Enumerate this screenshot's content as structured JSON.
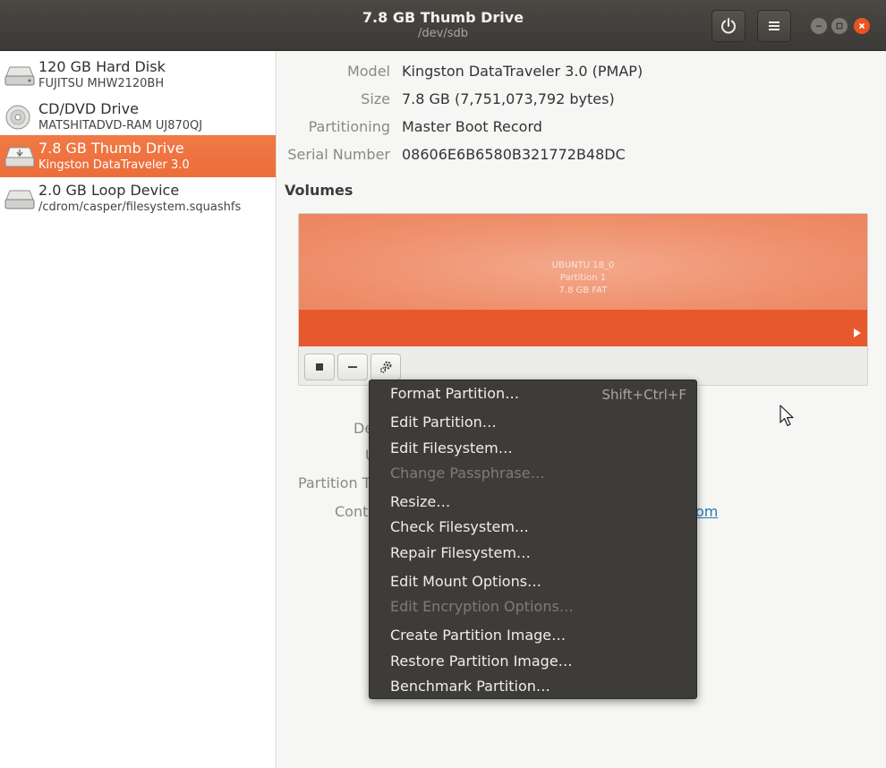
{
  "window": {
    "title": "7.8 GB Thumb Drive",
    "subtitle": "/dev/sdb"
  },
  "icons": {
    "power": "power-icon",
    "menu": "hamburger-menu-icon",
    "minimize": "minimize-icon",
    "maximize": "maximize-icon",
    "close": "close-icon"
  },
  "sidebar": {
    "items": [
      {
        "name": "120 GB Hard Disk",
        "sub": "FUJITSU MHW2120BH",
        "icon": "hard-disk-icon",
        "selected": false
      },
      {
        "name": "CD/DVD Drive",
        "sub": "MATSHITADVD-RAM UJ870QJ",
        "icon": "optical-disc-icon",
        "selected": false
      },
      {
        "name": "7.8 GB Thumb Drive",
        "sub": "Kingston DataTraveler 3.0",
        "icon": "usb-drive-icon",
        "selected": true
      },
      {
        "name": "2.0 GB Loop Device",
        "sub": "/cdrom/casper/filesystem.squashfs",
        "icon": "loop-device-icon",
        "selected": false
      }
    ]
  },
  "properties": {
    "model_label": "Model",
    "model_value": "Kingston DataTraveler 3.0 (PMAP)",
    "size_label": "Size",
    "size_value": "7.8 GB (7,751,073,792 bytes)",
    "partitioning_label": "Partitioning",
    "partitioning_value": "Master Boot Record",
    "serial_label": "Serial Number",
    "serial_value": "08606E6B6580B321772B48DC"
  },
  "volumes": {
    "heading": "Volumes",
    "partition_name": "UBUNTU 18_0",
    "partition_number": "Partition 1",
    "partition_size": "7.8 GB FAT"
  },
  "partially_hidden": {
    "device_fragment": "De",
    "uuid_fragment": "U",
    "partition_type_fragment": "Partition T",
    "contents_fragment": "Cont",
    "link_fragment": "om"
  },
  "menu": {
    "items": [
      {
        "label": "Format Partition…",
        "accel": "Shift+Ctrl+F",
        "enabled": true
      },
      {
        "label": "Edit Partition…",
        "accel": "",
        "enabled": true
      },
      {
        "label": "Edit Filesystem…",
        "accel": "",
        "enabled": true
      },
      {
        "label": "Change Passphrase…",
        "accel": "",
        "enabled": false
      },
      {
        "label": "Resize…",
        "accel": "",
        "enabled": true
      },
      {
        "label": "Check Filesystem…",
        "accel": "",
        "enabled": true
      },
      {
        "label": "Repair Filesystem…",
        "accel": "",
        "enabled": true
      },
      {
        "label": "Edit Mount Options…",
        "accel": "",
        "enabled": true
      },
      {
        "label": "Edit Encryption Options…",
        "accel": "",
        "enabled": false
      },
      {
        "label": "Create Partition Image…",
        "accel": "",
        "enabled": true
      },
      {
        "label": "Restore Partition Image…",
        "accel": "",
        "enabled": true
      },
      {
        "label": "Benchmark Partition…",
        "accel": "",
        "enabled": true
      }
    ]
  },
  "colors": {
    "accent": "#e95420",
    "headerbar": "#3b3a36",
    "selection": "#ef7544",
    "menu_bg": "#3d3c38"
  }
}
